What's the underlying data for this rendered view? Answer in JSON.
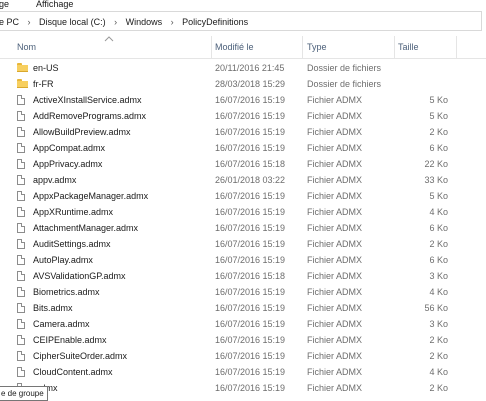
{
  "menu": {
    "item1": "age",
    "item2": "Affichage"
  },
  "address": {
    "crumbs": [
      "e PC",
      "Disque local (C:)",
      "Windows",
      "PolicyDefinitions"
    ],
    "separator": "›"
  },
  "columns": {
    "name": "Nom",
    "modified": "Modifié le",
    "type": "Type",
    "size": "Taille"
  },
  "rows": [
    {
      "icon": "folder-icon",
      "name": "en-US",
      "modified": "20/11/2016 21:45",
      "type": "Dossier de fichiers",
      "size": ""
    },
    {
      "icon": "folder-icon",
      "name": "fr-FR",
      "modified": "28/03/2018 15:29",
      "type": "Dossier de fichiers",
      "size": ""
    },
    {
      "icon": "file-icon",
      "name": "ActiveXInstallService.admx",
      "modified": "16/07/2016 15:19",
      "type": "Fichier ADMX",
      "size": "5 Ko"
    },
    {
      "icon": "file-icon",
      "name": "AddRemovePrograms.admx",
      "modified": "16/07/2016 15:19",
      "type": "Fichier ADMX",
      "size": "5 Ko"
    },
    {
      "icon": "file-icon",
      "name": "AllowBuildPreview.admx",
      "modified": "16/07/2016 15:19",
      "type": "Fichier ADMX",
      "size": "2 Ko"
    },
    {
      "icon": "file-icon",
      "name": "AppCompat.admx",
      "modified": "16/07/2016 15:19",
      "type": "Fichier ADMX",
      "size": "6 Ko"
    },
    {
      "icon": "file-icon",
      "name": "AppPrivacy.admx",
      "modified": "16/07/2016 15:18",
      "type": "Fichier ADMX",
      "size": "22 Ko"
    },
    {
      "icon": "file-icon",
      "name": "appv.admx",
      "modified": "26/01/2018 03:22",
      "type": "Fichier ADMX",
      "size": "33 Ko"
    },
    {
      "icon": "file-icon",
      "name": "AppxPackageManager.admx",
      "modified": "16/07/2016 15:19",
      "type": "Fichier ADMX",
      "size": "5 Ko"
    },
    {
      "icon": "file-icon",
      "name": "AppXRuntime.admx",
      "modified": "16/07/2016 15:19",
      "type": "Fichier ADMX",
      "size": "4 Ko"
    },
    {
      "icon": "file-icon",
      "name": "AttachmentManager.admx",
      "modified": "16/07/2016 15:19",
      "type": "Fichier ADMX",
      "size": "6 Ko"
    },
    {
      "icon": "file-icon",
      "name": "AuditSettings.admx",
      "modified": "16/07/2016 15:19",
      "type": "Fichier ADMX",
      "size": "2 Ko"
    },
    {
      "icon": "file-icon",
      "name": "AutoPlay.admx",
      "modified": "16/07/2016 15:19",
      "type": "Fichier ADMX",
      "size": "6 Ko"
    },
    {
      "icon": "file-icon",
      "name": "AVSValidationGP.admx",
      "modified": "16/07/2016 15:18",
      "type": "Fichier ADMX",
      "size": "3 Ko"
    },
    {
      "icon": "file-icon",
      "name": "Biometrics.admx",
      "modified": "16/07/2016 15:19",
      "type": "Fichier ADMX",
      "size": "4 Ko"
    },
    {
      "icon": "file-icon",
      "name": "Bits.admx",
      "modified": "16/07/2016 15:19",
      "type": "Fichier ADMX",
      "size": "56 Ko"
    },
    {
      "icon": "file-icon",
      "name": "Camera.admx",
      "modified": "16/07/2016 15:19",
      "type": "Fichier ADMX",
      "size": "3 Ko"
    },
    {
      "icon": "file-icon",
      "name": "CEIPEnable.admx",
      "modified": "16/07/2016 15:19",
      "type": "Fichier ADMX",
      "size": "2 Ko"
    },
    {
      "icon": "file-icon",
      "name": "CipherSuiteOrder.admx",
      "modified": "16/07/2016 15:19",
      "type": "Fichier ADMX",
      "size": "2 Ko"
    },
    {
      "icon": "file-icon",
      "name": "CloudContent.admx",
      "modified": "16/07/2016 15:19",
      "type": "Fichier ADMX",
      "size": "4 Ko"
    },
    {
      "icon": "file-icon",
      "name": ".admx",
      "modified": "16/07/2016 15:19",
      "type": "Fichier ADMX",
      "size": "2 Ko"
    }
  ],
  "tooltip": "e de groupe"
}
